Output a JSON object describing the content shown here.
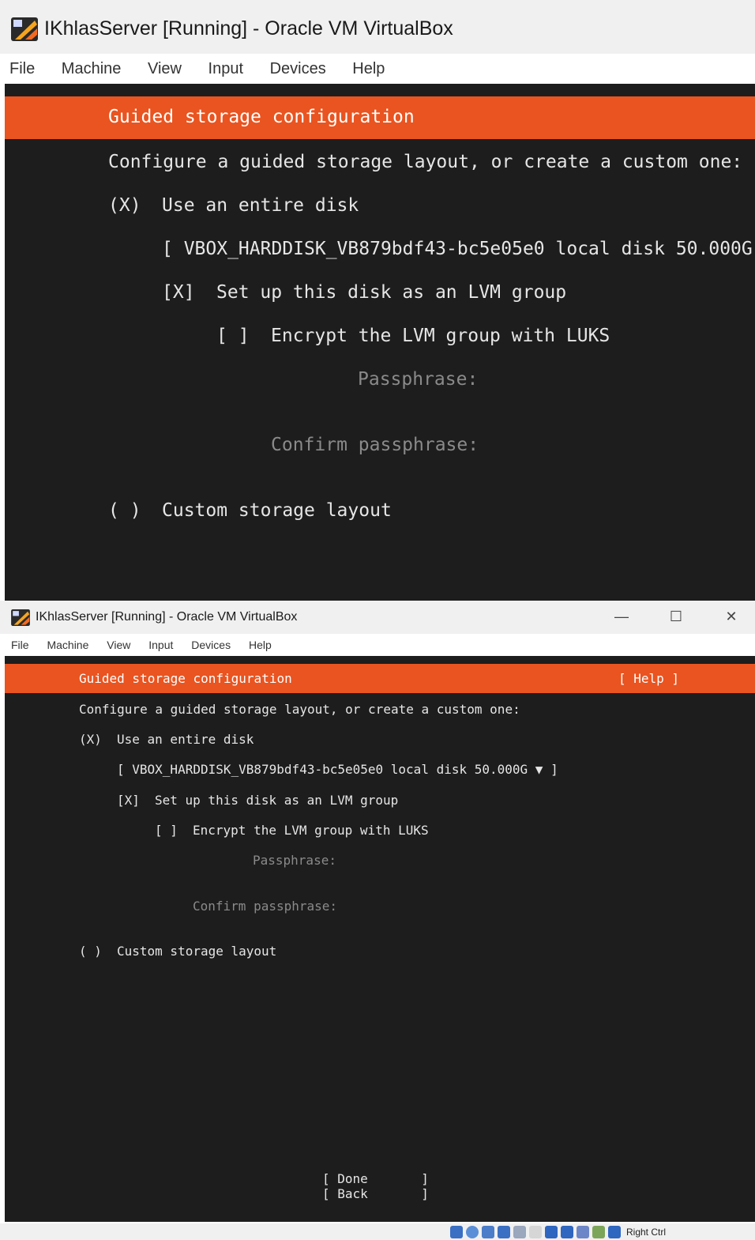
{
  "colors": {
    "accent": "#e95420",
    "terminal_bg": "#1d1d1d",
    "terminal_fg": "#e6e6e6",
    "dim_fg": "#8a8a8a"
  },
  "window": {
    "title": "IKhlasServer [Running] - Oracle VM VirtualBox",
    "menu": [
      "File",
      "Machine",
      "View",
      "Input",
      "Devices",
      "Help"
    ]
  },
  "installer": {
    "header": "Guided storage configuration",
    "help": "[ Help ]",
    "intro": "Configure a guided storage layout, or create a custom one:",
    "entire_disk_radio": "(X)",
    "entire_disk_label": "Use an entire disk",
    "disk_select_zoom": "[ VBOX_HARDDISK_VB879bdf43-bc5e05e0 local disk 50.000G",
    "disk_select": "[ VBOX_HARDDISK_VB879bdf43-bc5e05e0 local disk 50.000G ▼ ]",
    "lvm_check": "[X]",
    "lvm_label": "Set up this disk as an LVM group",
    "luks_check": "[ ]",
    "luks_label": "Encrypt the LVM group with LUKS",
    "passphrase_label": "Passphrase:",
    "confirm_label": "Confirm passphrase:",
    "custom_radio": "( )",
    "custom_label": "Custom storage layout",
    "done_button": "[ Done       ]",
    "back_button": "[ Back       ]"
  },
  "statusbar": {
    "host_key": "Right Ctrl"
  }
}
